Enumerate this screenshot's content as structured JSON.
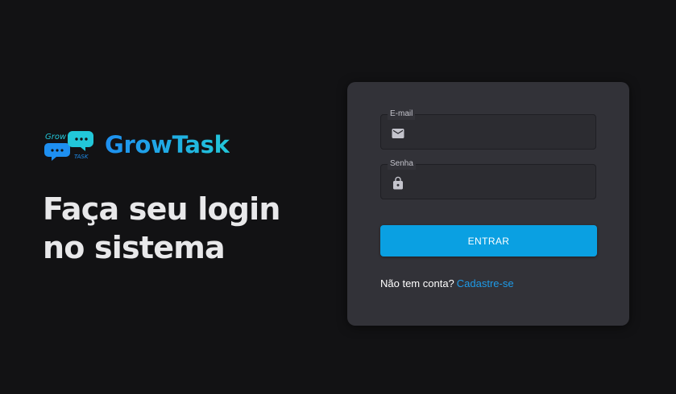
{
  "brand": {
    "name": "GrowTask",
    "logo_text_top": "Grow",
    "logo_text_bottom": "TASK"
  },
  "hero": {
    "headline_line1": "Faça seu login",
    "headline_line2": "no sistema"
  },
  "login_form": {
    "email": {
      "label": "E-mail",
      "value": "",
      "icon": "mail-icon"
    },
    "password": {
      "label": "Senha",
      "value": "",
      "icon": "lock-icon"
    },
    "submit_label": "ENTRAR",
    "signup_prompt": "Não tem conta?",
    "signup_link": "Cadastre-se"
  },
  "colors": {
    "background": "#121214",
    "card": "#323238",
    "accent": "#0aa0e2",
    "link": "#1e9be8",
    "brand_gradient_start": "#1e8ff0",
    "brand_gradient_end": "#22c7d9"
  }
}
